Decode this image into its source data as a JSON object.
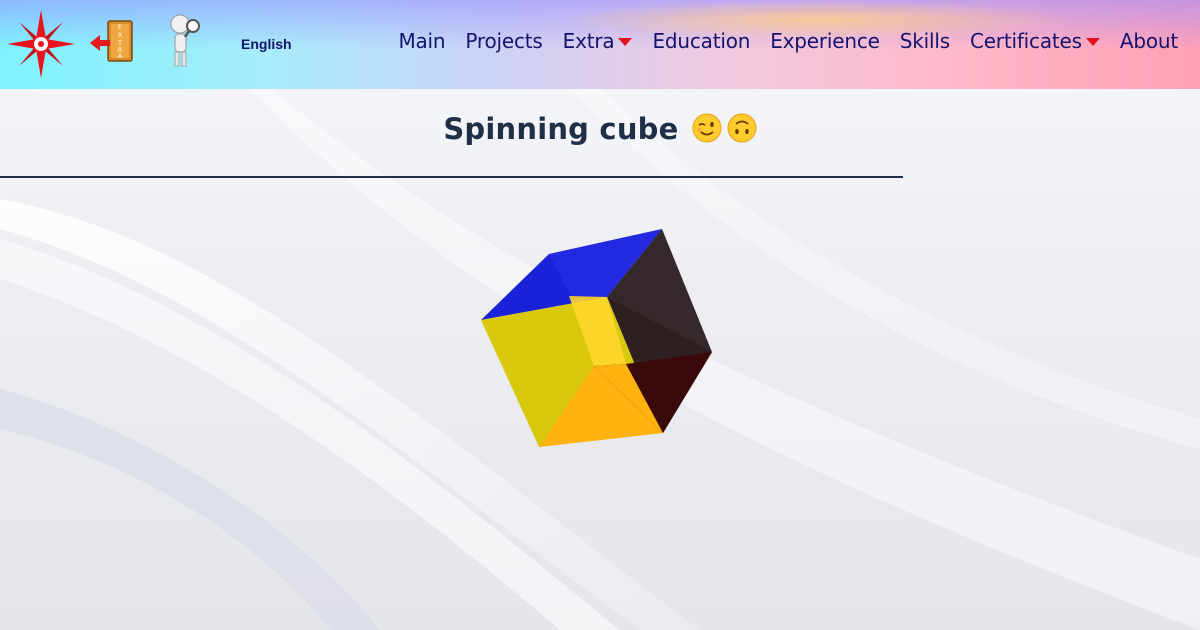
{
  "header": {
    "logos": [
      {
        "icon": "compass-rose-icon"
      },
      {
        "icon": "extra-exit-door-icon",
        "text": "EXTRA"
      },
      {
        "icon": "magnifier-figure-icon"
      }
    ],
    "language": "English",
    "nav": [
      {
        "label": "Main",
        "dropdown": false
      },
      {
        "label": "Projects",
        "dropdown": false
      },
      {
        "label": "Extra",
        "dropdown": true
      },
      {
        "label": "Education",
        "dropdown": false
      },
      {
        "label": "Experience",
        "dropdown": false
      },
      {
        "label": "Skills",
        "dropdown": false
      },
      {
        "label": "Certificates",
        "dropdown": true
      },
      {
        "label": "About",
        "dropdown": false
      }
    ],
    "caret_color": "#e5101d",
    "nav_color": "#14146e"
  },
  "main": {
    "title": "Spinning cube",
    "title_emojis": [
      "winking-face-emoji",
      "upside-down-face-emoji"
    ],
    "title_color": "#1f2f45",
    "cube_faces": {
      "top": "#1a22d8",
      "right": "#2b1c1f",
      "left": "#d8c90c",
      "bottom": "#ffb20f"
    }
  }
}
